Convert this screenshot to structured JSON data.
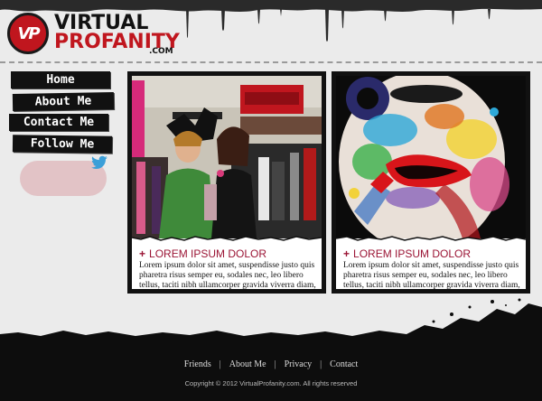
{
  "brand": {
    "badge": "VP",
    "name_top": "VIRTUAL",
    "name_bottom": "PROFANITY",
    "suffix": ".COM",
    "accent_color": "#c0161e"
  },
  "nav": {
    "items": [
      {
        "label": "Home"
      },
      {
        "label": "About Me"
      },
      {
        "label": "Contact Me"
      },
      {
        "label": "Follow Me"
      }
    ]
  },
  "social": {
    "icon": "twitter-bird-icon"
  },
  "cards": [
    {
      "title": "LOREM IPSUM DOLOR",
      "body": "Lorem ipsum dolor sit amet, suspendisse justo quis pharetra risus semper eu, sodales nec, leo libero tellus, taciti nibh ullamcorper gravida viverra diam,"
    },
    {
      "title": "LOREM IPSUM DOLOR",
      "body": "Lorem ipsum dolor sit amet, suspendisse justo quis pharetra risus semper eu, sodales nec, leo libero tellus, taciti nibh ullamcorper gravida viverra diam,"
    }
  ],
  "footer": {
    "links": [
      "Friends",
      "About Me",
      "Privacy",
      "Contact"
    ],
    "copyright": "Copyright © 2012 VirtualProfanity.com. All rights reserved"
  }
}
